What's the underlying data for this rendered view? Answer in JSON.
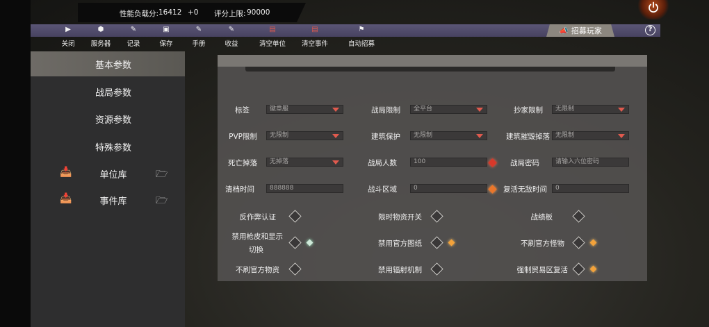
{
  "stats": {
    "load_label": "性能负载分:",
    "load_value": "16412",
    "load_delta": "+0",
    "limit_label": "评分上限:",
    "limit_value": "90000"
  },
  "toolbar": {
    "items": [
      {
        "label": "关闭",
        "icon": "play-icon"
      },
      {
        "label": "服务器",
        "icon": "cube-icon"
      },
      {
        "label": "记录",
        "icon": "note-icon"
      },
      {
        "label": "保存",
        "icon": "save-icon"
      },
      {
        "label": "手册",
        "icon": "manual-icon"
      },
      {
        "label": "收益",
        "icon": "edit-icon"
      },
      {
        "label": "清空单位",
        "icon": "trash-icon"
      },
      {
        "label": "清空事件",
        "icon": "trash-icon"
      },
      {
        "label": "自动招募",
        "icon": "flag-icon"
      }
    ],
    "recruit_label": "招募玩家",
    "help_label": "?"
  },
  "sidebar": {
    "items": [
      {
        "label": "基本参数",
        "active": true
      },
      {
        "label": "战局参数"
      },
      {
        "label": "资源参数"
      },
      {
        "label": "特殊参数"
      },
      {
        "label": "单位库",
        "icon_left": "import-icon",
        "icon_right": "add-folder-icon"
      },
      {
        "label": "事件库",
        "icon_left": "import-icon",
        "icon_right": "add-folder-icon"
      }
    ]
  },
  "fields": {
    "tag": {
      "label": "标签",
      "value": "徽章服"
    },
    "match_limit": {
      "label": "战局限制",
      "value": "全平台"
    },
    "raid_limit": {
      "label": "抄家限制",
      "value": "无限制"
    },
    "pvp_limit": {
      "label": "PVP限制",
      "value": "无限制"
    },
    "building_protect": {
      "label": "建筑保护",
      "value": "无限制"
    },
    "building_drop": {
      "label": "建筑摧毁掉落",
      "value": "无限制"
    },
    "death_drop": {
      "label": "死亡掉落",
      "value": "无掉落"
    },
    "player_count": {
      "label": "战局人数",
      "value": "100"
    },
    "match_password": {
      "label": "战局密码",
      "placeholder": "请输入六位密码"
    },
    "wipe_time": {
      "label": "清档时间",
      "value": "888888"
    },
    "battle_zone": {
      "label": "战斗区域",
      "value": "0"
    },
    "respawn_invincible": {
      "label": "复活无敌时间",
      "value": "0"
    }
  },
  "toggles": [
    {
      "label": "反作弊认证",
      "gem": ""
    },
    {
      "label": "限时物资开关",
      "gem": ""
    },
    {
      "label": "战绩板",
      "gem": ""
    },
    {
      "label": "禁用枪皮和显示",
      "label2": "切换",
      "gem": "green"
    },
    {
      "label": "禁用官方图纸",
      "gem": "gold"
    },
    {
      "label": "不刷官方怪物",
      "gem": "gold"
    },
    {
      "label": "不刷官方物资",
      "gem": ""
    },
    {
      "label": "禁用辐射机制",
      "gem": ""
    },
    {
      "label": "强制贸易区复活",
      "gem": "gold"
    }
  ]
}
